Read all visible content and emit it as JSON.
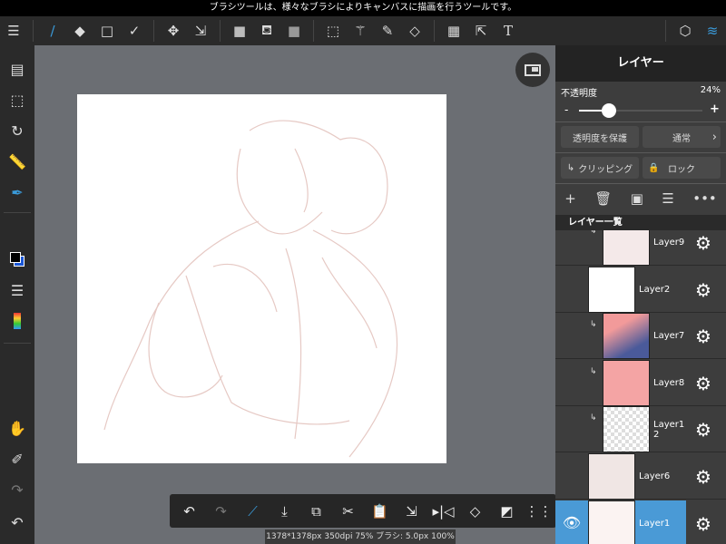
{
  "hint": "ブラシツールは、様々なブラシによりキャンバスに描画を行うツールです。",
  "toolbar": {
    "icons": [
      "menu-icon",
      "brush-icon",
      "eraser-icon",
      "rectangle-icon",
      "magic-brush-icon",
      "move-icon",
      "transform-icon",
      "fill-color-icon",
      "bucket-icon",
      "gradient-icon",
      "select-rect-icon",
      "magic-wand-icon",
      "select-pen-icon",
      "select-eraser-icon",
      "frame-icon",
      "object-select-icon",
      "text-icon",
      "materials-icon",
      "layers-icon"
    ]
  },
  "status": "1378*1378px 350dpi 75% ブラシ: 5.0px 100%",
  "panel": {
    "title": "レイヤー",
    "opacity_label": "不透明度",
    "opacity_value": "24%",
    "opacity_fraction": 0.24,
    "minus": "-",
    "plus": "+",
    "protect_alpha": "透明度を保護",
    "blend_mode": "通常",
    "clipping": "クリッピング",
    "lock": "ロック",
    "list_header": "レイヤー一覧",
    "layers": [
      {
        "name": "Layer9",
        "clipped": true
      },
      {
        "name": "Layer2",
        "clipped": false
      },
      {
        "name": "Layer7",
        "clipped": true
      },
      {
        "name": "Layer8",
        "clipped": true
      },
      {
        "name": "Layer12",
        "clipped": true
      },
      {
        "name": "Layer6",
        "clipped": false
      },
      {
        "name": "Layer1",
        "clipped": false,
        "selected": true
      }
    ]
  },
  "colors": {
    "accent": "#4a9ad6",
    "primary": "#000000",
    "secondary": "#1a56d6"
  }
}
